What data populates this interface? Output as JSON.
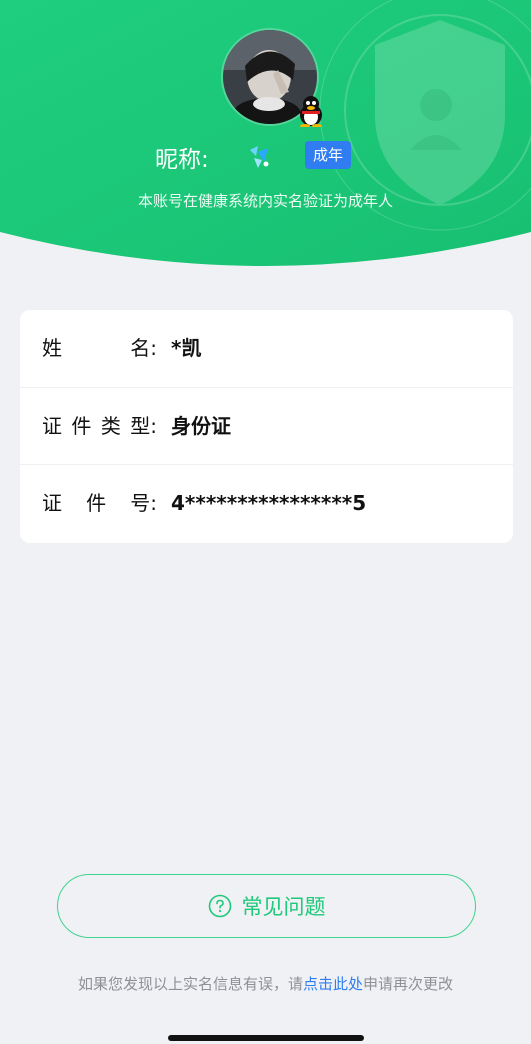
{
  "profile": {
    "nickname_label": "昵称:",
    "adult_badge": "成年",
    "verify_note": "本账号在健康系统内实名验证为成年人"
  },
  "info": {
    "rows": [
      {
        "label_chars": [
          "姓",
          "名:"
        ],
        "value": "*凯"
      },
      {
        "label_chars": [
          "证",
          "件",
          "类",
          "型:"
        ],
        "value": "身份证"
      },
      {
        "label_chars": [
          "证",
          "件",
          "号:"
        ],
        "value": "4****************5"
      }
    ]
  },
  "faq": {
    "label": "常见问题"
  },
  "footer": {
    "prefix": "如果您发现以上实名信息有误，请",
    "link": "点击此处",
    "suffix": "申请再次更改"
  },
  "colors": {
    "header_green": "#1ec97a",
    "accent_blue": "#2f7df0",
    "page_bg": "#f0f1f5"
  }
}
